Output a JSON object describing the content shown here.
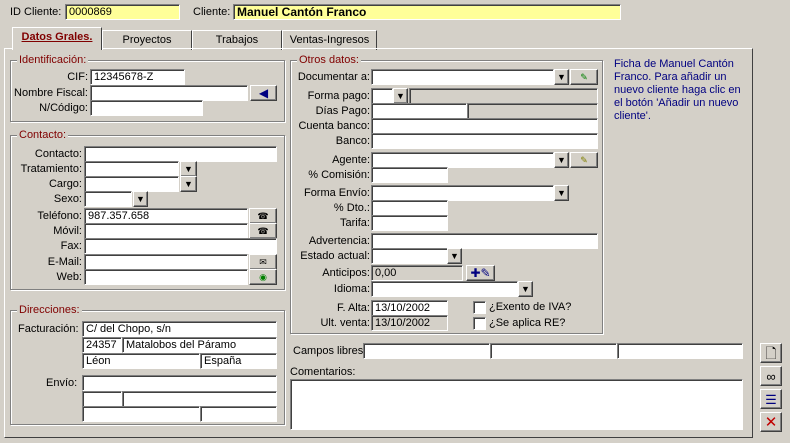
{
  "header": {
    "id_label": "ID Cliente:",
    "id_value": "0000869",
    "client_label": "Cliente:",
    "client_value": "Manuel Cantón Franco"
  },
  "tabs": [
    {
      "label": "Datos Grales.",
      "active": true
    },
    {
      "label": "Proyectos"
    },
    {
      "label": "Trabajos"
    },
    {
      "label": "Ventas-Ingresos"
    }
  ],
  "identificacion": {
    "title": "Identificación:",
    "cif_label": "CIF:",
    "cif_value": "12345678-Z",
    "nombre_fiscal_label": "Nombre Fiscal:",
    "nombre_fiscal_value": "",
    "ncodigo_label": "N/Código:",
    "ncodigo_value": ""
  },
  "contacto": {
    "title": "Contacto:",
    "contacto_label": "Contacto:",
    "tratamiento_label": "Tratamiento:",
    "cargo_label": "Cargo:",
    "sexo_label": "Sexo:",
    "telefono_label": "Teléfono:",
    "telefono_value": "987.357.658",
    "movil_label": "Móvil:",
    "fax_label": "Fax:",
    "email_label": "E-Mail:",
    "web_label": "Web:"
  },
  "direcciones": {
    "title": "Direcciones:",
    "facturacion_label": "Facturación:",
    "calle": "C/ del Chopo, s/n",
    "cp": "24357",
    "localidad": "Matalobos del Páramo",
    "provincia": "Léon",
    "pais": "España",
    "envio_label": "Envío:"
  },
  "otros": {
    "title": "Otros datos:",
    "documentar_label": "Documentar a:",
    "forma_pago_label": "Forma pago:",
    "dias_pago_label": "Días Pago:",
    "cuenta_banco_label": "Cuenta banco:",
    "banco_label": "Banco:",
    "agente_label": "Agente:",
    "comision_label": "% Comisión:",
    "forma_envio_label": "Forma Envío:",
    "dto_label": "% Dto.:",
    "tarifa_label": "Tarifa:",
    "advertencia_label": "Advertencia:",
    "estado_label": "Estado actual:",
    "anticipos_label": "Anticipos:",
    "anticipos_value": "0,00",
    "idioma_label": "Idioma:",
    "f_alta_label": "F. Alta:",
    "f_alta_value": "13/10/2002",
    "ult_venta_label": "Ult. venta:",
    "ult_venta_value": "13/10/2002",
    "exento_iva_label": "¿Exento de IVA?",
    "aplica_re_label": "¿Se aplica RE?"
  },
  "hint": "Ficha de Manuel Cantón Franco. Para añadir un nuevo cliente haga clic en el botón 'Añadir un nuevo cliente'.",
  "campos_libres_label": "Campos libres:",
  "comentarios_label": "Comentarios:",
  "colors": {
    "accent": "#800000",
    "hint": "#000080",
    "highlight": "#ffff99"
  }
}
